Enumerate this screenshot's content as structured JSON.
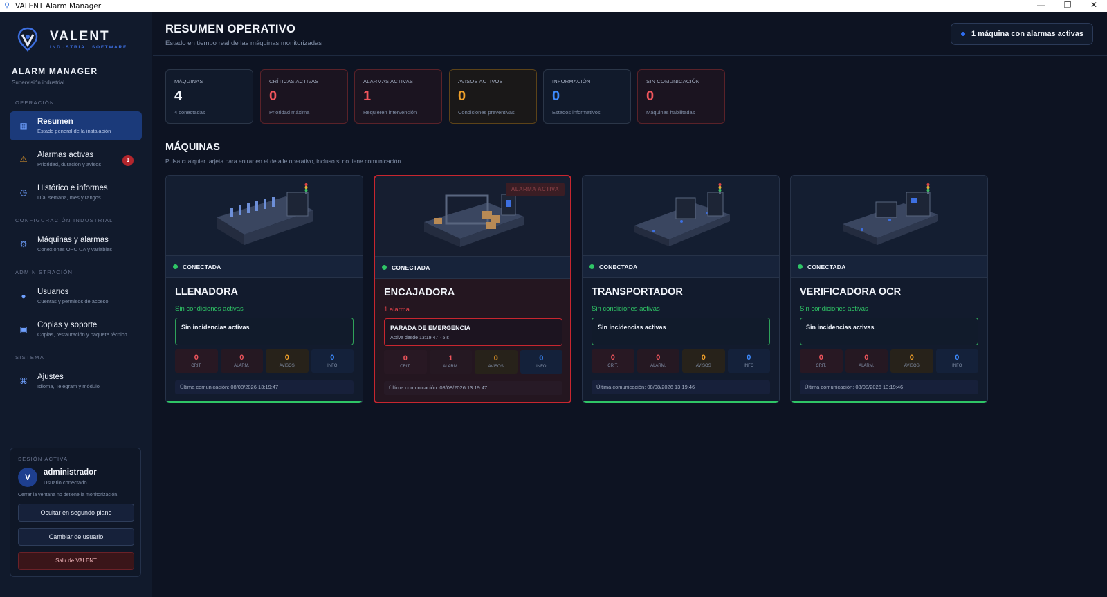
{
  "window": {
    "title": "VALENT Alarm Manager",
    "controls": [
      "—",
      "❐",
      "✕"
    ]
  },
  "sidebar": {
    "brand_name": "VALENT",
    "brand_sub": "INDUSTRIAL SOFTWARE",
    "app_name": "ALARM MANAGER",
    "app_sub": "Supervisión industrial",
    "sections": {
      "operacion": "OPERACIÓN",
      "config": "CONFIGURACIÓN INDUSTRIAL",
      "admin": "ADMINISTRACIÓN",
      "sistema": "SISTEMA"
    },
    "items": [
      {
        "label": "Resumen",
        "desc": "Estado general de la instalación",
        "icon": "grid-icon"
      },
      {
        "label": "Alarmas activas",
        "desc": "Prioridad, duración y avisos",
        "icon": "warning-icon",
        "badge": "1"
      },
      {
        "label": "Histórico e informes",
        "desc": "Día, semana, mes y rangos",
        "icon": "clock-icon"
      },
      {
        "label": "Máquinas y alarmas",
        "desc": "Conexiones OPC UA y variables",
        "icon": "gear-icon"
      },
      {
        "label": "Usuarios",
        "desc": "Cuentas y permisos de acceso",
        "icon": "user-icon"
      },
      {
        "label": "Copias y soporte",
        "desc": "Copias, restauración y paquete técnico",
        "icon": "backup-icon"
      },
      {
        "label": "Ajustes",
        "desc": "Idioma, Telegram y módulo",
        "icon": "command-icon"
      }
    ],
    "session": {
      "label": "SESIÓN ACTIVA",
      "avatar": "V",
      "user": "administrador",
      "status": "Usuario conectado",
      "note": "Cerrar la ventana no detiene la monitorización.",
      "btn_hide": "Ocultar en segundo plano",
      "btn_switch": "Cambiar de usuario",
      "btn_exit": "Salir de VALENT"
    }
  },
  "header": {
    "title": "RESUMEN OPERATIVO",
    "subtitle": "Estado en tiempo real de las máquinas monitorizadas",
    "status": "1 máquina con alarmas activas"
  },
  "stats": [
    {
      "title": "MÁQUINAS",
      "value": "4",
      "desc": "4 conectadas"
    },
    {
      "title": "CRÍTICAS ACTIVAS",
      "value": "0",
      "desc": "Prioridad máxima"
    },
    {
      "title": "ALARMAS ACTIVAS",
      "value": "1",
      "desc": "Requieren intervención"
    },
    {
      "title": "AVISOS ACTIVOS",
      "value": "0",
      "desc": "Condiciones preventivas"
    },
    {
      "title": "INFORMACIÓN",
      "value": "0",
      "desc": "Estados informativos"
    },
    {
      "title": "SIN COMUNICACIÓN",
      "value": "0",
      "desc": "Máquinas habilitadas"
    }
  ],
  "machines_section": {
    "title": "MÁQUINAS",
    "subtitle": "Pulsa cualquier tarjeta para entrar en el detalle operativo, incluso si no tiene comunicación."
  },
  "counter_labels": {
    "crit": "CRIT.",
    "alarm": "ALARM.",
    "avisos": "AVISOS",
    "info": "INFO"
  },
  "machines": [
    {
      "name": "LLENADORA",
      "connection": "CONECTADA",
      "status": "Sin condiciones activas",
      "incident": "Sin incidencias activas",
      "incident_detail": "",
      "crit": "0",
      "alarm": "0",
      "avisos": "0",
      "info": "0",
      "last_comm": "Última comunicación: 08/08/2026 13:19:47"
    },
    {
      "name": "ENCAJADORA",
      "connection": "CONECTADA",
      "status": "1 alarma",
      "tag": "ALARMA ACTIVA",
      "incident": "PARADA DE EMERGENCIA",
      "incident_detail": "Activa desde 13:19:47 · 5 s",
      "crit": "0",
      "alarm": "1",
      "avisos": "0",
      "info": "0",
      "last_comm": "Última comunicación: 08/08/2026 13:19:47"
    },
    {
      "name": "TRANSPORTADOR",
      "connection": "CONECTADA",
      "status": "Sin condiciones activas",
      "incident": "Sin incidencias activas",
      "incident_detail": "",
      "crit": "0",
      "alarm": "0",
      "avisos": "0",
      "info": "0",
      "last_comm": "Última comunicación: 08/08/2026 13:19:46"
    },
    {
      "name": "VERIFICADORA OCR",
      "connection": "CONECTADA",
      "status": "Sin condiciones activas",
      "incident": "Sin incidencias activas",
      "incident_detail": "",
      "crit": "0",
      "alarm": "0",
      "avisos": "0",
      "info": "0",
      "last_comm": "Última comunicación: 08/08/2026 13:19:46"
    }
  ],
  "colors": {
    "accent": "#1b3a7a",
    "ok": "#2fc566",
    "alarm": "#c7262f",
    "warning": "#f0a02a",
    "info": "#3d8bff"
  }
}
